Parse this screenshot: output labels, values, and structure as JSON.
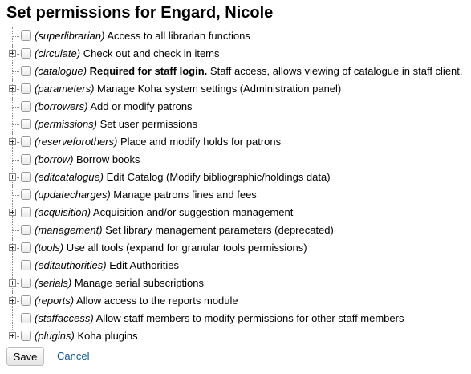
{
  "page_title": "Set permissions for Engard, Nicole",
  "permissions": [
    {
      "code": "(superlibrarian)",
      "description": "Access to all librarian functions",
      "expandable": false
    },
    {
      "code": "(circulate)",
      "description": "Check out and check in items",
      "expandable": true
    },
    {
      "code": "(catalogue)",
      "description_bold": "Required for staff login.",
      "description": "Staff access, allows viewing of catalogue in staff client.",
      "expandable": false
    },
    {
      "code": "(parameters)",
      "description": "Manage Koha system settings (Administration panel)",
      "expandable": true
    },
    {
      "code": "(borrowers)",
      "description": "Add or modify patrons",
      "expandable": false
    },
    {
      "code": "(permissions)",
      "description": "Set user permissions",
      "expandable": false
    },
    {
      "code": "(reserveforothers)",
      "description": "Place and modify holds for patrons",
      "expandable": true
    },
    {
      "code": "(borrow)",
      "description": "Borrow books",
      "expandable": false
    },
    {
      "code": "(editcatalogue)",
      "description": "Edit Catalog (Modify bibliographic/holdings data)",
      "expandable": true
    },
    {
      "code": "(updatecharges)",
      "description": "Manage patrons fines and fees",
      "expandable": false
    },
    {
      "code": "(acquisition)",
      "description": "Acquisition and/or suggestion management",
      "expandable": true
    },
    {
      "code": "(management)",
      "description": "Set library management parameters (deprecated)",
      "expandable": false
    },
    {
      "code": "(tools)",
      "description": "Use all tools (expand for granular tools permissions)",
      "expandable": true
    },
    {
      "code": "(editauthorities)",
      "description": "Edit Authorities",
      "expandable": false
    },
    {
      "code": "(serials)",
      "description": "Manage serial subscriptions",
      "expandable": true
    },
    {
      "code": "(reports)",
      "description": "Allow access to the reports module",
      "expandable": true
    },
    {
      "code": "(staffaccess)",
      "description": "Allow staff members to modify permissions for other staff members",
      "expandable": false
    },
    {
      "code": "(plugins)",
      "description": "Koha plugins",
      "expandable": true
    }
  ],
  "actions": {
    "save_label": "Save",
    "cancel_label": "Cancel"
  },
  "colors": {
    "link": "#0b57a8",
    "tree_line": "#888888"
  }
}
